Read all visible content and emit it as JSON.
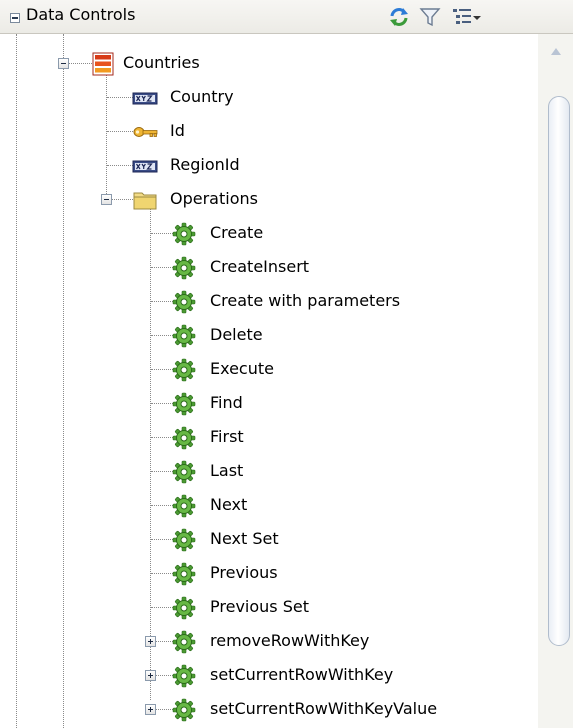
{
  "header": {
    "title": "Data Controls",
    "refresh_icon": "refresh-icon",
    "filter_icon": "filter-icon",
    "view_menu_icon": "tree-view-menu-icon"
  },
  "tree": {
    "root": {
      "label": "Countries",
      "icon": "data-collection-icon",
      "expanded": true
    },
    "attributes": [
      {
        "label": "Country",
        "icon": "string-attribute-icon"
      },
      {
        "label": "Id",
        "icon": "key-icon"
      },
      {
        "label": "RegionId",
        "icon": "string-attribute-icon"
      }
    ],
    "operations_folder": {
      "label": "Operations",
      "icon": "folder-icon",
      "expanded": true
    },
    "operations": [
      {
        "label": "Create",
        "icon": "operation-icon"
      },
      {
        "label": "CreateInsert",
        "icon": "operation-icon"
      },
      {
        "label": "Create with parameters",
        "icon": "operation-icon"
      },
      {
        "label": "Delete",
        "icon": "operation-icon"
      },
      {
        "label": "Execute",
        "icon": "operation-icon"
      },
      {
        "label": "Find",
        "icon": "operation-icon"
      },
      {
        "label": "First",
        "icon": "operation-icon"
      },
      {
        "label": "Last",
        "icon": "operation-icon"
      },
      {
        "label": "Next",
        "icon": "operation-icon"
      },
      {
        "label": "Next Set",
        "icon": "operation-icon"
      },
      {
        "label": "Previous",
        "icon": "operation-icon"
      },
      {
        "label": "Previous Set",
        "icon": "operation-icon"
      }
    ],
    "methods": [
      {
        "label": "removeRowWithKey",
        "icon": "operation-icon",
        "expandable": true
      },
      {
        "label": "setCurrentRowWithKey",
        "icon": "operation-icon",
        "expandable": true
      },
      {
        "label": "setCurrentRowWithKeyValue",
        "icon": "operation-icon",
        "expandable": true
      }
    ]
  },
  "colors": {
    "header_bg": "#ecebe6",
    "tree_line": "#8a8a8a",
    "gear_green": "#5aa83b",
    "folder_yellow": "#f0d570",
    "collection_red": "#d83a16",
    "key_gold": "#e8a92a"
  }
}
